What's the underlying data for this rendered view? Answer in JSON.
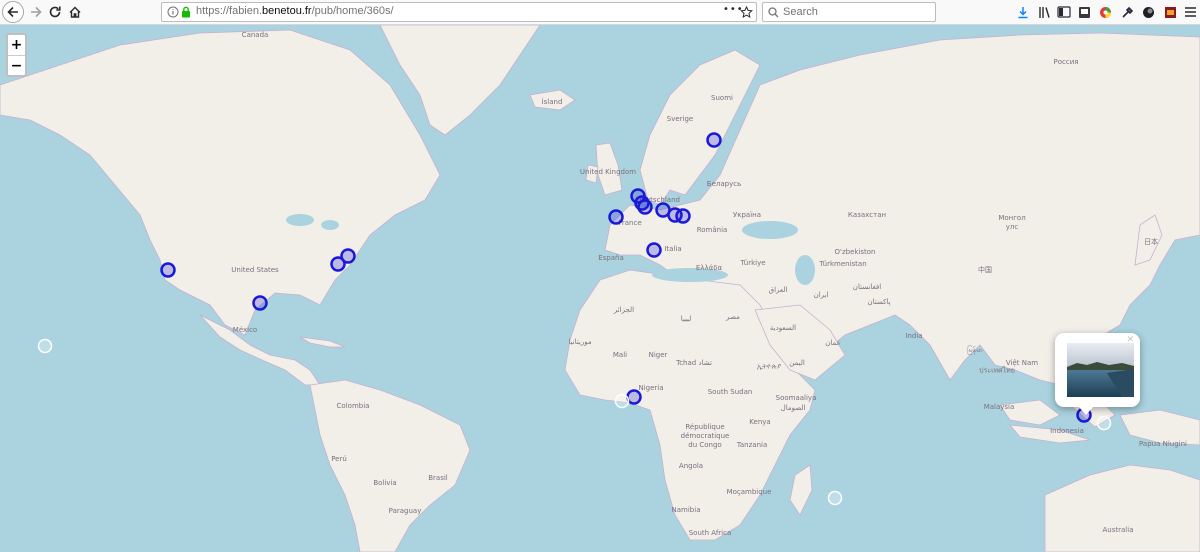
{
  "browser": {
    "url_prefix": "https://fabien.",
    "url_domain": "benetou.fr",
    "url_path": "/pub/home/360s/",
    "search_placeholder": "Search",
    "page_actions_label": "•••"
  },
  "map": {
    "zoom_in_label": "+",
    "zoom_out_label": "−",
    "labels": [
      {
        "id": "canada",
        "text": "Canada"
      },
      {
        "id": "united-states",
        "text": "United States"
      },
      {
        "id": "mexico",
        "text": "México"
      },
      {
        "id": "island",
        "text": "Ísland"
      },
      {
        "id": "suomi",
        "text": "Suomi"
      },
      {
        "id": "sverige",
        "text": "Sverige"
      },
      {
        "id": "uk",
        "text": "United Kingdom"
      },
      {
        "id": "deutschland",
        "text": "Deutschland"
      },
      {
        "id": "belarus",
        "text": "Беларусь"
      },
      {
        "id": "ukraina",
        "text": "Україна"
      },
      {
        "id": "france",
        "text": "France"
      },
      {
        "id": "romania",
        "text": "România"
      },
      {
        "id": "espana",
        "text": "España"
      },
      {
        "id": "italia",
        "text": "Italia"
      },
      {
        "id": "ellada",
        "text": "Ελλάδα"
      },
      {
        "id": "turkiye",
        "text": "Türkiye"
      },
      {
        "id": "rossiya",
        "text": "Россия"
      },
      {
        "id": "kazakhstan",
        "text": "Казахстан"
      },
      {
        "id": "uzbekiston",
        "text": "O'zbekiston"
      },
      {
        "id": "turkmenistan",
        "text": "Türkmenistan"
      },
      {
        "id": "mongol",
        "text": "Монгол"
      },
      {
        "id": "mongol2",
        "text": "улс"
      },
      {
        "id": "nihon",
        "text": "日本"
      },
      {
        "id": "china",
        "text": "中国"
      },
      {
        "id": "iraq",
        "text": "العراق"
      },
      {
        "id": "iran",
        "text": "ایران"
      },
      {
        "id": "afghanistan",
        "text": "افغانستان"
      },
      {
        "id": "pakistan",
        "text": "پاکستان"
      },
      {
        "id": "india",
        "text": "India"
      },
      {
        "id": "algeria",
        "text": "الجزائر"
      },
      {
        "id": "libya",
        "text": "ليبيا"
      },
      {
        "id": "egypt",
        "text": "مصر"
      },
      {
        "id": "saudi",
        "text": "السعودية"
      },
      {
        "id": "oman",
        "text": "عمان"
      },
      {
        "id": "yemen",
        "text": "اليمن"
      },
      {
        "id": "mauritania",
        "text": "موريتانيا"
      },
      {
        "id": "mali",
        "text": "Mali"
      },
      {
        "id": "niger",
        "text": "Niger"
      },
      {
        "id": "tchad",
        "text": "Tchad تشاد"
      },
      {
        "id": "ethiopia",
        "text": "ኢትዮጵያ"
      },
      {
        "id": "nigeria",
        "text": "Nigeria"
      },
      {
        "id": "south-sudan",
        "text": "South Sudan"
      },
      {
        "id": "somaliya",
        "text": "Soomaaliya"
      },
      {
        "id": "somaliya2",
        "text": "الصومال"
      },
      {
        "id": "kenya",
        "text": "Kenya"
      },
      {
        "id": "rdc1",
        "text": "République"
      },
      {
        "id": "rdc2",
        "text": "démocratique"
      },
      {
        "id": "rdc3",
        "text": "du Congo"
      },
      {
        "id": "tanzania",
        "text": "Tanzania"
      },
      {
        "id": "angola",
        "text": "Angola"
      },
      {
        "id": "mocambique",
        "text": "Moçambique"
      },
      {
        "id": "namibia",
        "text": "Namibia"
      },
      {
        "id": "south-africa",
        "text": "South Africa"
      },
      {
        "id": "colombia",
        "text": "Colombia"
      },
      {
        "id": "peru",
        "text": "Perú"
      },
      {
        "id": "brasil",
        "text": "Brasil"
      },
      {
        "id": "bolivia",
        "text": "Bolivia"
      },
      {
        "id": "paraguay",
        "text": "Paraguay"
      },
      {
        "id": "myanmar",
        "text": "မြန်မာ"
      },
      {
        "id": "vietnam",
        "text": "Việt Nam"
      },
      {
        "id": "thailand",
        "text": "ประเทศไทย"
      },
      {
        "id": "malaysia",
        "text": "Malaysia"
      },
      {
        "id": "indonesia",
        "text": "Indonesia"
      },
      {
        "id": "papua",
        "text": "Papua Niugini"
      },
      {
        "id": "australia",
        "text": "Australia"
      }
    ],
    "marker_count": 19,
    "colors": {
      "ocean": "#aad3df",
      "land": "#f2efe9",
      "border": "#c79bd0",
      "marker": "#1a1ad6"
    }
  }
}
